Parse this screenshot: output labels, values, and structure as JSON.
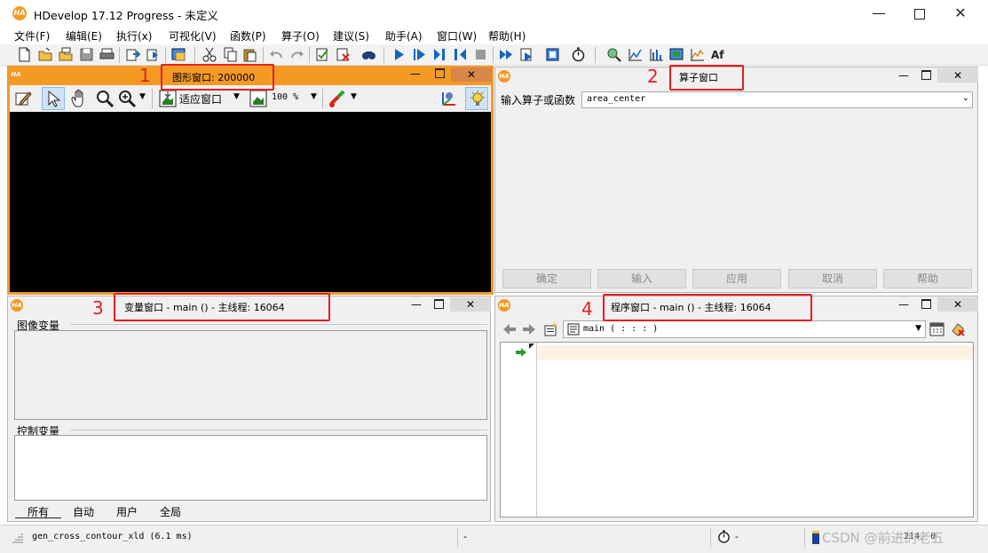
{
  "window": {
    "title": "HDevelop 17.12 Progress - 未定义",
    "logo": "HA"
  },
  "menu": [
    "文件(F)",
    "编辑(E)",
    "执行(x)",
    "可视化(V)",
    "函数(P)",
    "算子(O)",
    "建议(S)",
    "助手(A)",
    "窗口(W)",
    "帮助(H)"
  ],
  "graphics_window": {
    "title": "图形窗口: 200000",
    "annotation": "1",
    "fit_label": "适应窗口",
    "zoom_label": "100 %"
  },
  "operator_window": {
    "title": "算子窗口",
    "annotation": "2",
    "input_label": "输入算子或函数",
    "input_value": "area_center",
    "buttons": {
      "ok": "确定",
      "enter": "输入",
      "apply": "应用",
      "cancel": "取消",
      "help": "帮助"
    }
  },
  "variable_window": {
    "title": "变量窗口 - main () - 主线程: 16064",
    "annotation": "3",
    "iconic_label": "图像变量",
    "control_label": "控制变量",
    "tabs": [
      "所有",
      "自动",
      "用户",
      "全局"
    ]
  },
  "program_window": {
    "title": "程序窗口 - main () - 主线程: 16064",
    "annotation": "4",
    "procedure_value": "main ( : : : )"
  },
  "statusbar": {
    "message": "gen_cross_contour_xld (6.1 ms)",
    "dash1": "-",
    "dash2": "-",
    "position": "214, 0",
    "watermark": "CSDN @前进的老五"
  },
  "colors": {
    "accent": "#f39a25",
    "annotation": "#e81e1e",
    "graphics_bg": "#000000"
  }
}
